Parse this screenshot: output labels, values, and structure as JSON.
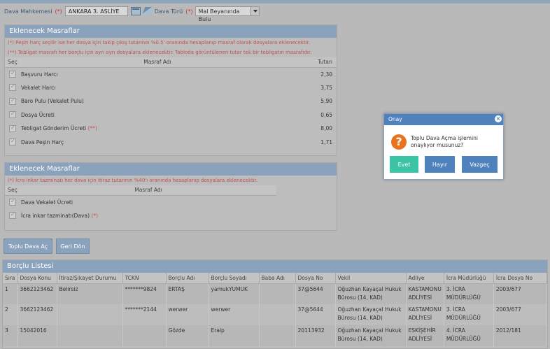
{
  "filters": {
    "mahkeme_label": "Dava Mahkemesi",
    "mahkeme_req": "(*)",
    "mahkeme_value": "ANKARA 3. ASLİYE",
    "tur_label": "Dava Türü",
    "tur_req": "(*)",
    "tur_value": "Mal Beyanında Bulu"
  },
  "masraf1": {
    "title": "Eklenecek Masraflar",
    "notes": [
      "(*) Peşin harç seçilir ise her dosya için takip çıkış tutarının %0.5' oranında hesaplanıp masraf olarak dosyalara eklenecektir.",
      "(**) Tebligat masrafı her borçlu için ayrı ayrı dosyalara eklenecektir. Tabloda görüntülenen tutar tek bir tebligatın masrafıdır."
    ],
    "headers": {
      "sec": "Seç",
      "ad": "Masraf Adı",
      "tutar": "Tutarı"
    },
    "rows": [
      {
        "ad": "Başvuru Harcı",
        "mark": "",
        "tutar": "2,30"
      },
      {
        "ad": "Vekalet Harcı",
        "mark": "",
        "tutar": "3,75"
      },
      {
        "ad": "Baro Pulu (Vekalet Pulu)",
        "mark": "",
        "tutar": "5,90"
      },
      {
        "ad": "Dosya Ücreti",
        "mark": "",
        "tutar": "0,65"
      },
      {
        "ad": "Tebligat Gönderim Ücreti",
        "mark": "(**)",
        "tutar": "8,00"
      },
      {
        "ad": "Dava Peşin Harç",
        "mark": "",
        "tutar": "1,71"
      }
    ]
  },
  "masraf2": {
    "title": "Eklenecek Masraflar",
    "note": "(*) İcra inkar tazminatı her dava için itiraz tutarının %40'ı oranında hesaplanıp dosyalara eklenecektir.",
    "headers": {
      "sec": "Seç",
      "ad": "Masraf Adı"
    },
    "rows": [
      {
        "ad": "Dava Vekalet Ücreti",
        "mark": ""
      },
      {
        "ad": "İcra inkar tazminatı(Dava)",
        "mark": "(*)"
      }
    ]
  },
  "buttons": {
    "toplu": "Toplu Dava Aç",
    "geri": "Geri Dön"
  },
  "borclu": {
    "title": "Borçlu Listesi",
    "headers": [
      "Sıra",
      "Dosya Konu",
      "İtiraz/Şikayet Durumu",
      "TCKN",
      "Borçlu Adı",
      "Borçlu Soyadı",
      "Baba Adı",
      "Dosya No",
      "Vekil",
      "Adliye",
      "İcra Müdürlüğü",
      "İcra Dosya No"
    ],
    "rows": [
      [
        "1",
        "3662123462",
        "Belirsiz",
        "*******9824",
        "ERTAŞ",
        "yamukYUMUK",
        "",
        "37@5644",
        "Oğuzhan Kayaçal Hukuk Bürosu (14, KAD)",
        "KASTAMONU ADLİYESİ",
        "3. İCRA MÜDÜRLÜĞÜ",
        "2003/677"
      ],
      [
        "2",
        "3662123462",
        "",
        "*******2144",
        "werwer",
        "werwer",
        "",
        "37@5644",
        "Oğuzhan Kayaçal Hukuk Bürosu (14, KAD)",
        "KASTAMONU ADLİYESİ",
        "3. İCRA MÜDÜRLÜĞÜ",
        "2003/677"
      ],
      [
        "3",
        "15042016",
        "",
        "",
        "Gözde",
        "Eralp",
        "",
        "20113932",
        "Oğuzhan Kayaçal Hukuk Bürosu (14, KAD)",
        "ESKİŞEHİR ADLİYESİ",
        "4. İCRA MÜDÜRLÜĞÜ",
        "2012/181"
      ]
    ]
  },
  "dialog": {
    "title": "Onay",
    "message": "Toplu Dava Açma işlemini onaylıyor musunuz?",
    "evet": "Evet",
    "hayir": "Hayır",
    "vazgec": "Vazgeç",
    "colors": {
      "evet": "#3cc4a6",
      "hayir": "#4f81bd",
      "vazgec": "#4f81bd"
    }
  }
}
